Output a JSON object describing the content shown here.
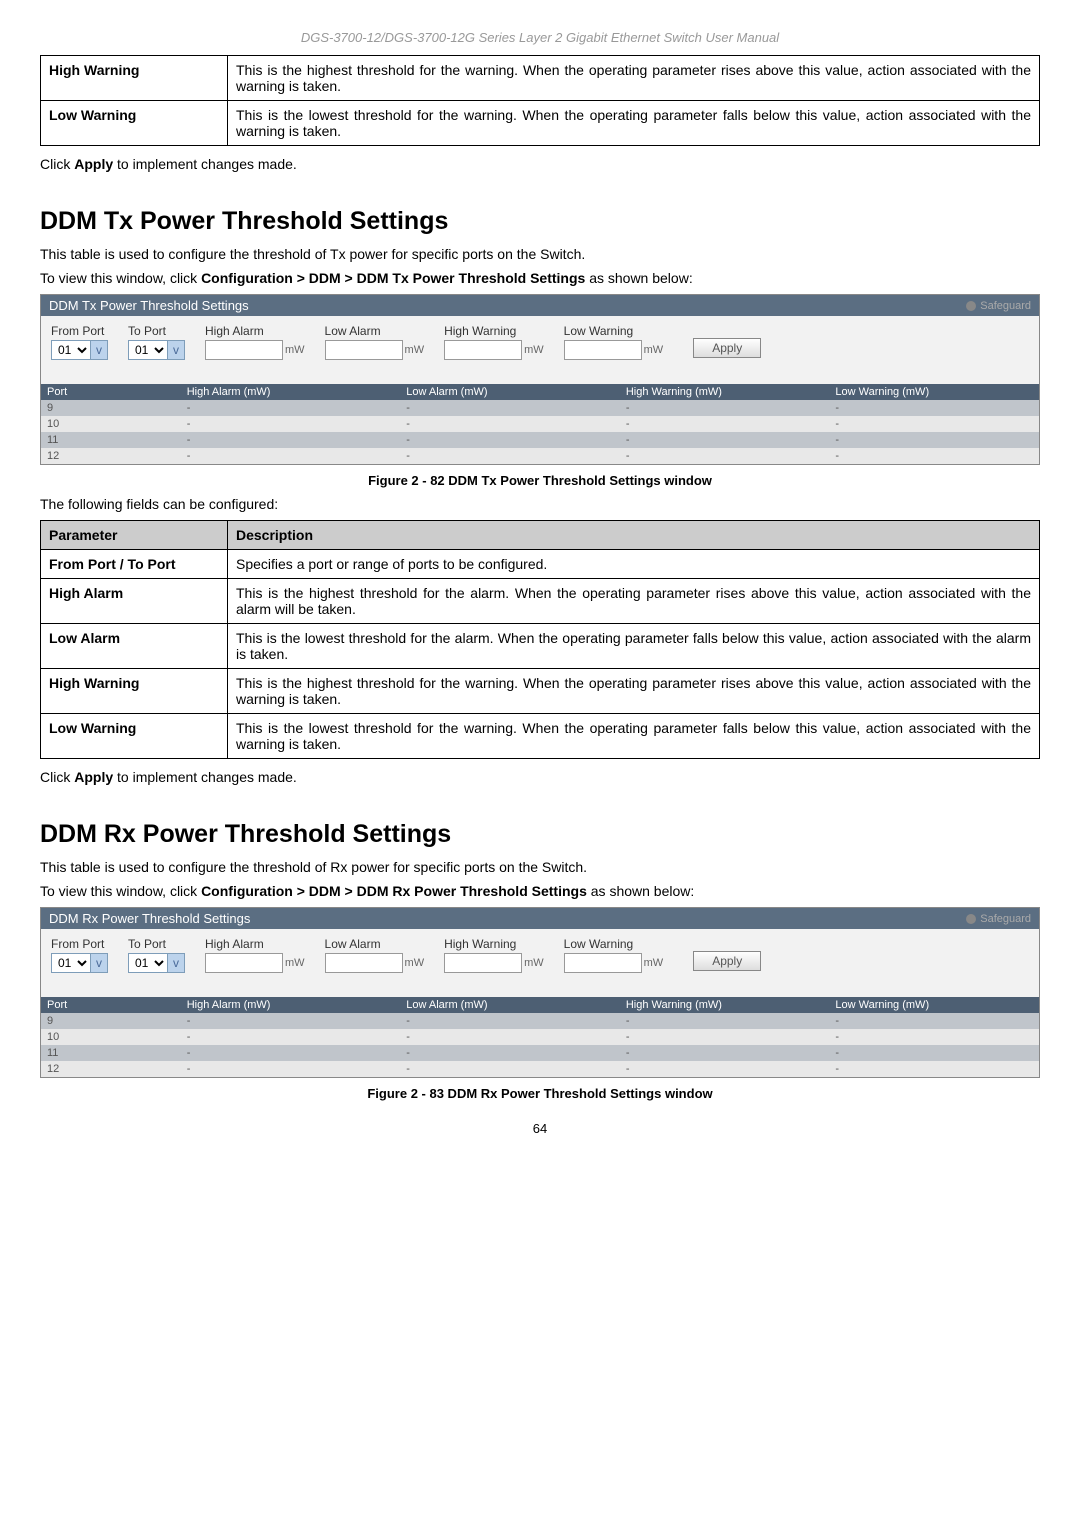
{
  "header": "DGS-3700-12/DGS-3700-12G Series Layer 2 Gigabit Ethernet Switch User Manual",
  "topTable": {
    "rows": [
      {
        "label": "High Warning",
        "desc": "This is the highest threshold for the warning. When the operating parameter rises above this value, action associated with the warning is taken."
      },
      {
        "label": "Low Warning",
        "desc": "This is the lowest threshold for the warning. When the operating parameter falls below this value, action associated with the warning is taken."
      }
    ]
  },
  "applyText1": {
    "click": "Click ",
    "apply": "Apply",
    "rest": " to implement changes made."
  },
  "tx": {
    "heading": "DDM Tx Power Threshold Settings",
    "intro": "This table is used to configure the threshold of Tx power for specific ports on the Switch.",
    "navPrefix": "To view this window, click ",
    "navBold": "Configuration > DDM > DDM Tx Power Threshold Settings",
    "navSuffix": " as shown below:",
    "panelTitle": "DDM Tx Power Threshold Settings",
    "safeguard": "Safeguard",
    "controls": {
      "fromPort": "From Port",
      "toPort": "To Port",
      "highAlarm": "High Alarm",
      "lowAlarm": "Low Alarm",
      "highWarning": "High Warning",
      "lowWarning": "Low Warning",
      "fromVal": "01",
      "toVal": "01",
      "unit": "mW",
      "apply": "Apply"
    },
    "tableHeaders": [
      "Port",
      "High Alarm (mW)",
      "Low Alarm (mW)",
      "High Warning (mW)",
      "Low Warning (mW)"
    ],
    "tableRows": [
      {
        "port": "9",
        "ha": "-",
        "la": "-",
        "hw": "-",
        "lw": "-"
      },
      {
        "port": "10",
        "ha": "-",
        "la": "-",
        "hw": "-",
        "lw": "-"
      },
      {
        "port": "11",
        "ha": "-",
        "la": "-",
        "hw": "-",
        "lw": "-"
      },
      {
        "port": "12",
        "ha": "-",
        "la": "-",
        "hw": "-",
        "lw": "-"
      }
    ],
    "caption": "Figure 2 - 82 DDM Tx Power Threshold Settings window",
    "fieldsIntro": "The following fields can be configured:",
    "paramHeader": {
      "p": "Parameter",
      "d": "Description"
    },
    "params": [
      {
        "label": "From Port / To Port",
        "desc": "Specifies a port or range of ports to be configured."
      },
      {
        "label": "High Alarm",
        "desc": "This is the highest threshold for the alarm. When the operating parameter rises above this value, action associated with the alarm will be taken."
      },
      {
        "label": "Low Alarm",
        "desc": "This is the lowest threshold for the alarm. When the operating parameter falls below this value, action associated with the alarm is taken."
      },
      {
        "label": "High Warning",
        "desc": "This is the highest threshold for the warning. When the operating parameter rises above this value, action associated with the warning is taken."
      },
      {
        "label": "Low Warning",
        "desc": "This is the lowest threshold for the warning. When the operating parameter falls below this value, action associated with the warning is taken."
      }
    ]
  },
  "rx": {
    "heading": "DDM Rx Power Threshold Settings",
    "intro": "This table is used to configure the threshold of Rx power for specific ports on the Switch.",
    "navPrefix": "To view this window, click ",
    "navBold": "Configuration > DDM > DDM Rx Power Threshold Settings",
    "navSuffix": " as shown below:",
    "panelTitle": "DDM Rx Power Threshold Settings",
    "safeguard": "Safeguard",
    "controls": {
      "fromPort": "From Port",
      "toPort": "To Port",
      "highAlarm": "High Alarm",
      "lowAlarm": "Low Alarm",
      "highWarning": "High Warning",
      "lowWarning": "Low Warning",
      "fromVal": "01",
      "toVal": "01",
      "unit": "mW",
      "apply": "Apply"
    },
    "tableHeaders": [
      "Port",
      "High Alarm (mW)",
      "Low Alarm (mW)",
      "High Warning (mW)",
      "Low Warning (mW)"
    ],
    "tableRows": [
      {
        "port": "9",
        "ha": "-",
        "la": "-",
        "hw": "-",
        "lw": "-"
      },
      {
        "port": "10",
        "ha": "-",
        "la": "-",
        "hw": "-",
        "lw": "-"
      },
      {
        "port": "11",
        "ha": "-",
        "la": "-",
        "hw": "-",
        "lw": "-"
      },
      {
        "port": "12",
        "ha": "-",
        "la": "-",
        "hw": "-",
        "lw": "-"
      }
    ],
    "caption": "Figure 2 - 83 DDM Rx Power Threshold Settings window"
  },
  "pageNum": "64"
}
